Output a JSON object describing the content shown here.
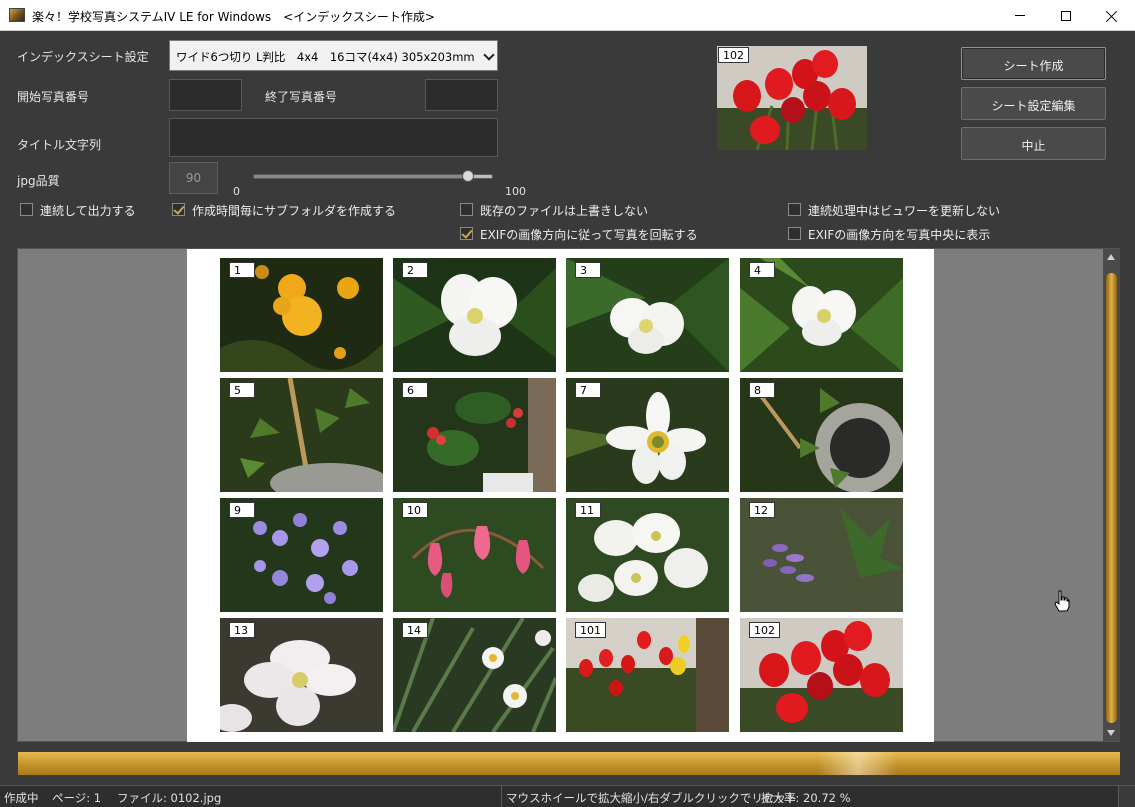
{
  "window": {
    "title": "楽々！学校写真システムIV LE for Windows　<インデックスシート作成>"
  },
  "form": {
    "index_setting_label": "インデックスシート設定",
    "index_setting_value": "ワイド6つ切り  L判比　4x4　16コマ(4x4) 305x203mm",
    "start_photo_label": "開始写真番号",
    "start_photo_value": "",
    "end_photo_label": "終了写真番号",
    "end_photo_value": "",
    "title_label": "タイトル文字列",
    "title_value": "",
    "jpg_quality_label": "jpg品質",
    "jpg_quality_value": "90",
    "slider_min": "0",
    "slider_max": "100",
    "slider_value": 90
  },
  "buttons": {
    "create_sheet": "シート作成",
    "edit_sheet_settings": "シート設定編集",
    "cancel": "中止"
  },
  "options": [
    {
      "label": "連続して出力する",
      "checked": false
    },
    {
      "label": "作成時間毎にサブフォルダを作成する",
      "checked": true
    },
    {
      "label": "既存のファイルは上書きしない",
      "checked": false
    },
    {
      "label": "連続処理中はビュワーを更新しない",
      "checked": false
    },
    {
      "label": "EXIFの画像方向に従って写真を回転する",
      "checked": true
    },
    {
      "label": "EXIFの画像方向を写真中央に表示",
      "checked": false
    }
  ],
  "preview": {
    "number": "102"
  },
  "sheet": {
    "photos": [
      "1",
      "2",
      "3",
      "4",
      "5",
      "6",
      "7",
      "8",
      "9",
      "10",
      "11",
      "12",
      "13",
      "14",
      "101",
      "102"
    ]
  },
  "progress": {
    "fraction": 1.0
  },
  "status": {
    "state": "作成中",
    "page": "ページ: 1",
    "file": "ファイル: 0102.jpg",
    "hint": "マウスホイールで拡大縮小/右ダブルクリックでリセット",
    "zoom": "拡大率: 20.72 %"
  },
  "colors": {
    "accent": "#d9a441",
    "background": "#3a3a3a",
    "progress": "#c59229"
  }
}
